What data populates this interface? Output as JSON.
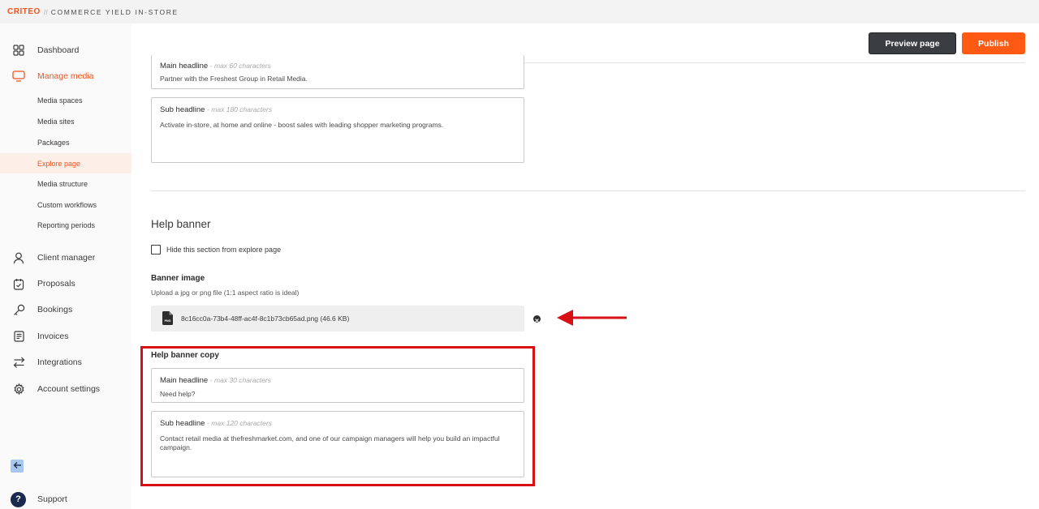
{
  "topbar": {
    "brand": "CRITEO",
    "separator": "//",
    "product": "COMMERCE YIELD IN-STORE"
  },
  "sidebar": {
    "items": [
      {
        "label": "Dashboard",
        "icon": "grid-icon"
      },
      {
        "label": "Manage media",
        "icon": "monitor-icon"
      },
      {
        "label": "Client manager",
        "icon": "user-icon"
      },
      {
        "label": "Proposals",
        "icon": "clipboard-icon"
      },
      {
        "label": "Bookings",
        "icon": "key-icon"
      },
      {
        "label": "Invoices",
        "icon": "invoice-icon"
      },
      {
        "label": "Integrations",
        "icon": "swap-arrows-icon"
      },
      {
        "label": "Account settings",
        "icon": "gear-icon"
      }
    ],
    "sub_items": [
      {
        "label": "Media spaces"
      },
      {
        "label": "Media sites"
      },
      {
        "label": "Packages"
      },
      {
        "label": "Explore page"
      },
      {
        "label": "Media structure"
      },
      {
        "label": "Custom workflows"
      },
      {
        "label": "Reporting periods"
      }
    ],
    "support_label": "Support",
    "accent_color": "#f0541f"
  },
  "toolbar": {
    "preview_label": "Preview page",
    "publish_label": "Publish"
  },
  "intro_copy": {
    "main_headline": {
      "label": "Main headline",
      "hint": "- max 60 characters",
      "value": "Partner with the Freshest Group in Retail Media."
    },
    "sub_headline": {
      "label": "Sub headline",
      "hint": "- max 180 characters",
      "value": "Activate in-store, at home and online - boost sales with leading shopper marketing programs."
    }
  },
  "help_banner": {
    "title": "Help banner",
    "hide_label": "Hide this section from explore page",
    "hide_checked": false,
    "image_title": "Banner image",
    "image_helper": "Upload a jpg or png file (1:1 aspect ratio is ideal)",
    "file_badge": "PNG",
    "file_name": "8c16cc0a-73b4-48ff-ac4f-8c1b73cb65ad.png (46.6 KB)",
    "copy_title": "Help banner copy",
    "main_headline": {
      "label": "Main headline",
      "hint": "- max 30 characters",
      "value": "Need help?"
    },
    "sub_headline": {
      "label": "Sub headline",
      "hint": "- max 120 characters",
      "value": "Contact retail media at thefreshmarket.com, and one of our campaign managers will help you build an impactful campaign."
    }
  },
  "annotations": {
    "highlight_color": "#d90f16"
  }
}
